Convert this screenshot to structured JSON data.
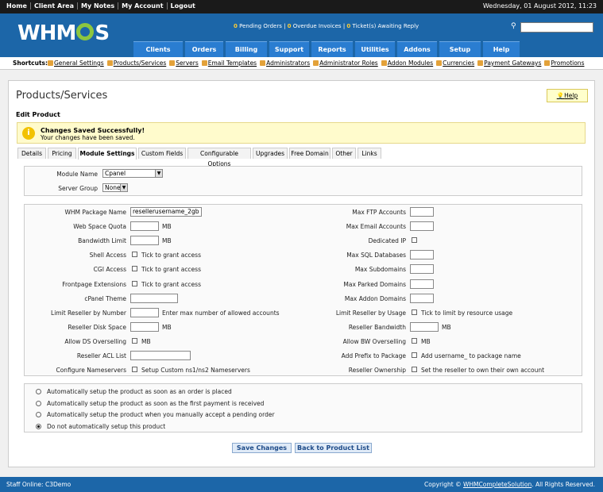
{
  "topbar": {
    "links": [
      "Home",
      "Client Area",
      "My Notes",
      "My Account",
      "Logout"
    ],
    "date": "Wednesday, 01 August 2012, 11:23"
  },
  "header": {
    "logo_left": "WHM",
    "logo_right": "S",
    "stats": {
      "pending_orders": "0",
      "pending_orders_label": "Pending Orders",
      "overdue": "0",
      "overdue_label": "Overdue Invoices",
      "tickets": "0",
      "tickets_label": "Ticket(s) Awaiting Reply"
    },
    "nav": [
      "Clients",
      "Orders",
      "Billing",
      "Support",
      "Reports",
      "Utilities",
      "Addons",
      "Setup",
      "Help"
    ]
  },
  "shortcuts": {
    "label": "Shortcuts:",
    "items": [
      "General Settings",
      "Products/Services",
      "Servers",
      "Email Templates",
      "Administrators",
      "Administrator Roles",
      "Addon Modules",
      "Currencies",
      "Payment Gateways",
      "Promotions"
    ]
  },
  "page": {
    "title": "Products/Services",
    "help": "Help",
    "subtitle": "Edit Product",
    "success_title": "Changes Saved Successfully!",
    "success_text": "Your changes have been saved.",
    "tabs": [
      "Details",
      "Pricing",
      "Module Settings",
      "Custom Fields",
      "Configurable Options",
      "Upgrades",
      "Free Domain",
      "Other",
      "Links"
    ],
    "active_tab": "Module Settings"
  },
  "module": {
    "module_name_label": "Module Name",
    "module_name_value": "Cpanel",
    "server_group_label": "Server Group",
    "server_group_value": "None"
  },
  "settings_left": [
    {
      "label": "WHM Package Name",
      "type": "input",
      "value": "resellerusername_2gb"
    },
    {
      "label": "Web Space Quota",
      "type": "input",
      "value": "",
      "suffix": "MB"
    },
    {
      "label": "Bandwidth Limit",
      "type": "input",
      "value": "",
      "suffix": "MB"
    },
    {
      "label": "Shell Access",
      "type": "check",
      "suffix": "Tick to grant access"
    },
    {
      "label": "CGI Access",
      "type": "check",
      "suffix": "Tick to grant access"
    },
    {
      "label": "Frontpage Extensions",
      "type": "check",
      "suffix": "Tick to grant access"
    },
    {
      "label": "cPanel Theme",
      "type": "input",
      "value": ""
    },
    {
      "label": "Limit Reseller by Number",
      "type": "input",
      "value": "",
      "suffix": "Enter max number of allowed accounts"
    },
    {
      "label": "Reseller Disk Space",
      "type": "input",
      "value": "",
      "suffix": "MB"
    },
    {
      "label": "Allow DS Overselling",
      "type": "check",
      "suffix": "MB"
    },
    {
      "label": "Reseller ACL List",
      "type": "input",
      "value": ""
    },
    {
      "label": "Configure Nameservers",
      "type": "check",
      "suffix": "Setup Custom ns1/ns2 Nameservers"
    }
  ],
  "settings_right": [
    {
      "label": "Max FTP Accounts",
      "type": "input",
      "value": ""
    },
    {
      "label": "Max Email Accounts",
      "type": "input",
      "value": ""
    },
    {
      "label": "Dedicated IP",
      "type": "check",
      "suffix": ""
    },
    {
      "label": "Max SQL Databases",
      "type": "input",
      "value": ""
    },
    {
      "label": "Max Subdomains",
      "type": "input",
      "value": ""
    },
    {
      "label": "Max Parked Domains",
      "type": "input",
      "value": ""
    },
    {
      "label": "Max Addon Domains",
      "type": "input",
      "value": ""
    },
    {
      "label": "Limit Reseller by Usage",
      "type": "check",
      "suffix": "Tick to limit by resource usage"
    },
    {
      "label": "Reseller Bandwidth",
      "type": "input",
      "value": "",
      "suffix": "MB"
    },
    {
      "label": "Allow BW Overselling",
      "type": "check",
      "suffix": "MB"
    },
    {
      "label": "Add Prefix to Package",
      "type": "check",
      "suffix": "Add username_ to package name"
    },
    {
      "label": "Reseller Ownership",
      "type": "check",
      "suffix": "Set the reseller to own their own account"
    }
  ],
  "setup_options": [
    {
      "label": "Automatically setup the product as soon as an order is placed",
      "selected": false
    },
    {
      "label": "Automatically setup the product as soon as the first payment is received",
      "selected": false
    },
    {
      "label": "Automatically setup the product when you manually accept a pending order",
      "selected": false
    },
    {
      "label": "Do not automatically setup this product",
      "selected": true
    }
  ],
  "buttons": {
    "save": "Save Changes",
    "back": "Back to Product List"
  },
  "footer": {
    "staff": "Staff Online: C3Demo",
    "copyright_pre": "Copyright ©",
    "copyright_link": "WHMCompleteSolution",
    "copyright_post": ". All Rights Reserved."
  }
}
